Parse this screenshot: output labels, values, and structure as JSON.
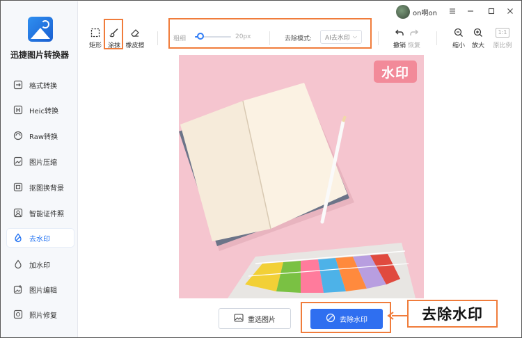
{
  "app": {
    "title": "迅捷图片转换器",
    "accent_color": "#1d6ff2",
    "highlight_color": "#f07c3b"
  },
  "titlebar": {
    "username": "on啊on",
    "avatar_icon": "avatar-image"
  },
  "sidebar": {
    "items": [
      {
        "label": "格式转换",
        "icon": "format-convert-icon"
      },
      {
        "label": "Heic转换",
        "icon": "heic-icon"
      },
      {
        "label": "Raw转换",
        "icon": "raw-icon"
      },
      {
        "label": "图片压缩",
        "icon": "compress-icon"
      },
      {
        "label": "抠图换背景",
        "icon": "cutout-icon"
      },
      {
        "label": "智能证件照",
        "icon": "id-photo-icon"
      },
      {
        "label": "去水印",
        "icon": "remove-watermark-icon",
        "active": true
      },
      {
        "label": "加水印",
        "icon": "add-watermark-icon"
      },
      {
        "label": "图片编辑",
        "icon": "edit-image-icon"
      },
      {
        "label": "照片修复",
        "icon": "repair-icon"
      }
    ]
  },
  "toolbar": {
    "tools": [
      {
        "label": "矩形",
        "icon": "rectangle-select-icon"
      },
      {
        "label": "涂抹",
        "icon": "brush-icon",
        "selected": true
      },
      {
        "label": "橡皮擦",
        "icon": "eraser-icon"
      }
    ],
    "brush_label": "粗细",
    "brush_value": "20px",
    "brush_level": 0.15,
    "mode_label": "去除模式:",
    "mode_value": "AI去水印",
    "undo_label": "撤销",
    "redo_label": "恢复",
    "zoom_out_label": "缩小",
    "zoom_in_label": "放大",
    "original_badge": "1:1",
    "original_label": "原比例"
  },
  "canvas": {
    "watermark_text": "水印"
  },
  "footer": {
    "reselect_label": "重选图片",
    "remove_label": "去除水印"
  },
  "callout": {
    "text": "去除水印"
  }
}
